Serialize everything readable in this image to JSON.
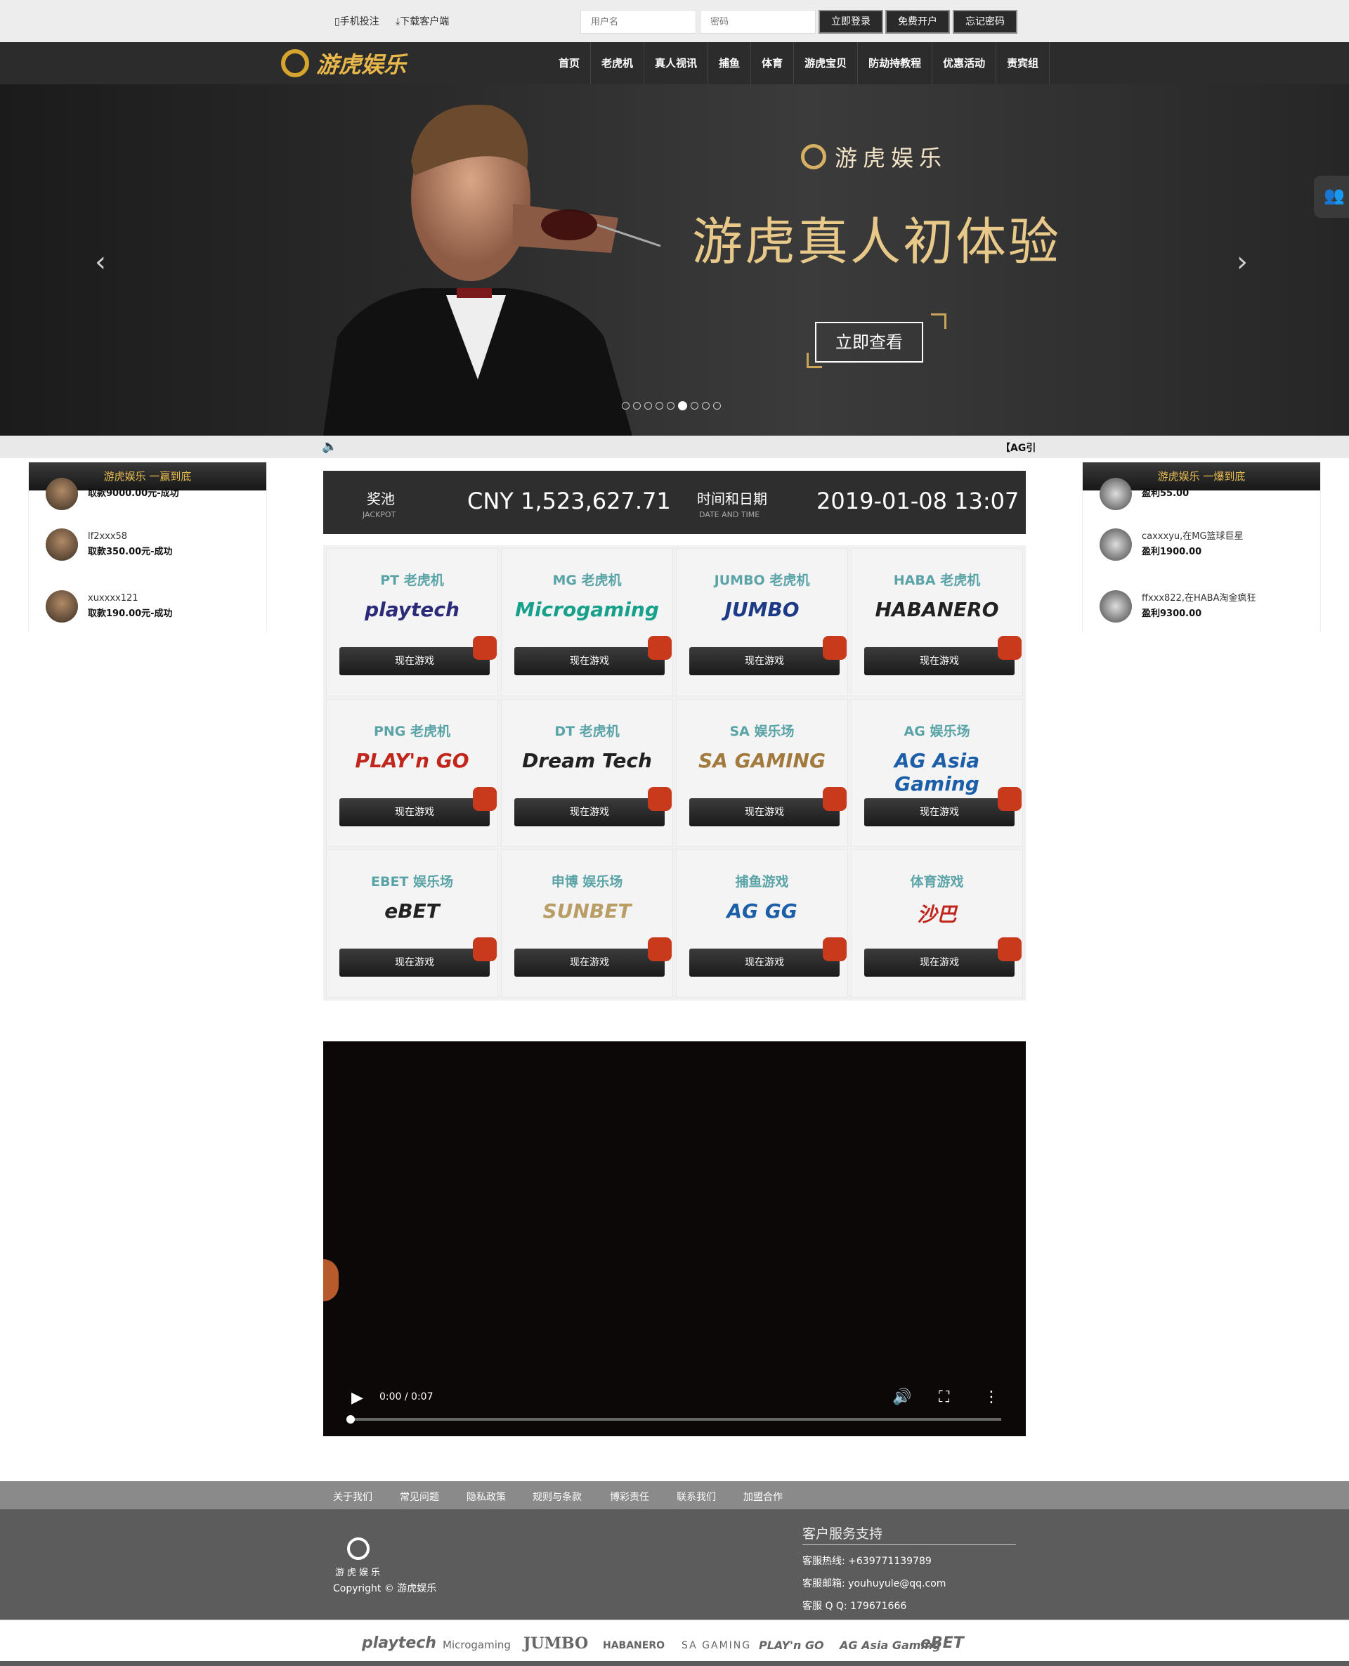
{
  "topbar": {
    "mobile_bet": "手机投注",
    "download_client": "下载客户端",
    "username_placeholder": "用户名",
    "password_placeholder": "密码",
    "login_button": "立即登录",
    "register_button": "免费开户",
    "forgot_button": "忘记密码"
  },
  "nav": {
    "logo_text": "游虎娱乐",
    "items": [
      "首页",
      "老虎机",
      "真人视讯",
      "捕鱼",
      "体育",
      "游虎宝贝",
      "防劫持教程",
      "优惠活动",
      "责宾组"
    ]
  },
  "banner": {
    "brand": "游虎娱乐",
    "title": "游虎真人初体验",
    "cta": "立即查看",
    "slide_count": 9,
    "active_slide": 6
  },
  "marquee": {
    "text": "【AG引"
  },
  "left_panel": {
    "title": "游虎娱乐  一赢到底",
    "rows": [
      {
        "user": "",
        "detail": "取款9000.00元-成功"
      },
      {
        "user": "lf2xxx58",
        "detail": "取款350.00元-成功"
      },
      {
        "user": "xuxxxx121",
        "detail": "取款190.00元-成功"
      }
    ]
  },
  "right_panel": {
    "title": "游虎娱乐  一爆到底",
    "rows": [
      {
        "user": "",
        "detail": "盈利55.00"
      },
      {
        "user": "caxxxyu,在MG篮球巨星",
        "detail": "盈利1900.00"
      },
      {
        "user": "ffxxx822,在HABA淘金疯狂",
        "detail": "盈利9300.00"
      }
    ]
  },
  "jackpot": {
    "label": "奖池",
    "label_en": "JACKPOT",
    "amount": "CNY 1,523,627.71",
    "time_label": "时间和日期",
    "time_label_en": "DATE AND TIME",
    "datetime": "2019-01-08 13:07"
  },
  "games": [
    {
      "title": "PT 老虎机",
      "logo": "playtech",
      "button": "现在游戏",
      "color": "#2b2b7a"
    },
    {
      "title": "MG 老虎机",
      "logo": "Microgaming",
      "button": "现在游戏",
      "color": "#17a18b"
    },
    {
      "title": "JUMBO 老虎机",
      "logo": "JUMBO",
      "button": "现在游戏",
      "color": "#1c3a86"
    },
    {
      "title": "HABA 老虎机",
      "logo": "HABANERO",
      "button": "现在游戏",
      "color": "#222222"
    },
    {
      "title": "PNG 老虎机",
      "logo": "PLAY'n GO",
      "button": "现在游戏",
      "color": "#c0261c"
    },
    {
      "title": "DT 老虎机",
      "logo": "Dream Tech",
      "button": "现在游戏",
      "color": "#222222"
    },
    {
      "title": "SA 娱乐场",
      "logo": "SA GAMING",
      "button": "现在游戏",
      "color": "#a27a3e"
    },
    {
      "title": "AG 娱乐场",
      "logo": "AG Asia Gaming",
      "button": "现在游戏",
      "color": "#1d5ea8"
    },
    {
      "title": "EBET 娱乐场",
      "logo": "eBET",
      "button": "现在游戏",
      "color": "#222222"
    },
    {
      "title": "申博 娱乐场",
      "logo": "SUNBET",
      "button": "现在游戏",
      "color": "#b99d67"
    },
    {
      "title": "捕鱼游戏",
      "logo": "AG GG",
      "button": "现在游戏",
      "color": "#1d5ea8"
    },
    {
      "title": "体育游戏",
      "logo": "沙巴",
      "button": "现在游戏",
      "color": "#c0261c"
    }
  ],
  "video": {
    "time": "0:00 / 0:07"
  },
  "footer": {
    "links": [
      "关于我们",
      "常见问题",
      "隐私政策",
      "规则与条款",
      "博彩责任",
      "联系我们",
      "加盟合作"
    ],
    "logo_text": "游虎娱乐",
    "copyright": "Copyright © 游虎娱乐",
    "support_title": "客户服务支持",
    "hotline": "客服热线:  +639771139789",
    "email": "客服邮箱:  youhuyule@qq.com",
    "qq": "客服 Q Q:  179671666",
    "partners": [
      "playtech",
      "Microgaming",
      "JUMBO",
      "HABANERO",
      "SA GAMING",
      "PLAY'n GO",
      "AG Asia Gaming",
      "eBET"
    ]
  }
}
